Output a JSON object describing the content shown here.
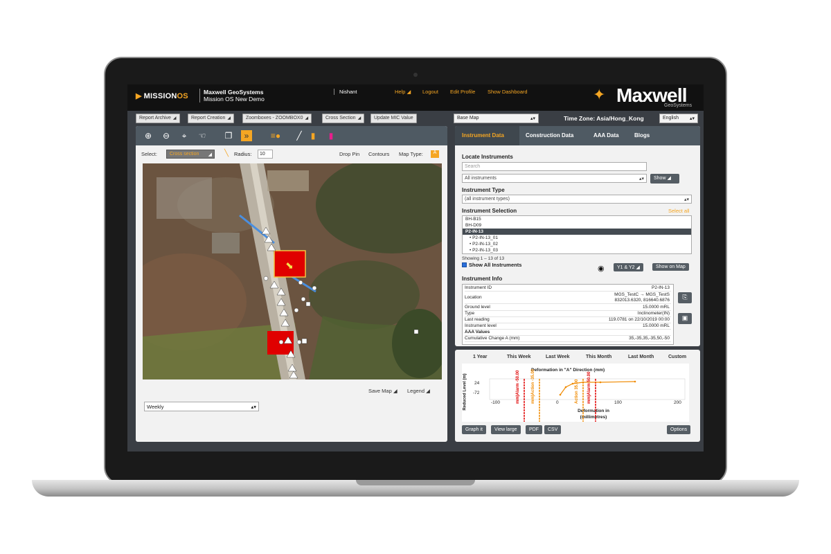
{
  "app": {
    "product_name": "MISSION",
    "product_suffix": "OS",
    "company": "Maxwell GeoSystems",
    "project": "Mission OS New Demo",
    "user": "Nishant",
    "nav": [
      "Help",
      "Logout",
      "Edit Profile",
      "Show Dashboard"
    ],
    "brand": "Maxwell",
    "brand_sub": "GeoSystems"
  },
  "toolbar": {
    "buttons": [
      "Report Archive",
      "Report Creation",
      "Zoomboxes - ZOOMBOX0",
      "Cross Section",
      "Update MIC Value"
    ],
    "basemap": "Base Map",
    "timezone": "Time Zone: Asia/Hong_Kong",
    "language": "English"
  },
  "map_panel": {
    "select_label": "Select:",
    "select_value": "Cross section",
    "radius_label": "Radius:",
    "radius_value": "10",
    "drop_pin": "Drop Pin",
    "contours": "Contours",
    "map_type": "Map Type:",
    "map_type_icon": "A",
    "save_map": "Save Map",
    "legend": "Legend",
    "period": "Weekly"
  },
  "right_panel": {
    "tabs": [
      "Instrument Data",
      "Construction Data",
      "AAA Data",
      "Blogs"
    ],
    "locate_title": "Locate Instruments",
    "search_placeholder": "Search",
    "all_instruments": "All instruments",
    "show_btn": "Show",
    "type_title": "Instrument Type",
    "type_value": "(all instrument types)",
    "selection_title": "Instrument Selection",
    "select_all": "Select all",
    "list": [
      "BH-B15",
      "BH-D09",
      "P2-IN-13",
      "• P2-IN-13_01",
      "• P2-IN-13_02",
      "• P2-IN-13_03"
    ],
    "showing": "Showing 1 – 13 of 13",
    "show_all": "Show All Instruments",
    "y_btn": "Y1 & Y2",
    "show_on_map": "Show on Map",
    "info_title": "Instrument Info",
    "info": [
      {
        "k": "Instrument ID",
        "v": "P2-IN-13"
      },
      {
        "k": "Location",
        "v": "MGS_TestC → MGS_TestS"
      },
      {
        "k": "",
        "v": "832013.6320, 816640.6876"
      },
      {
        "k": "Ground level",
        "v": "15.0000 mRL"
      },
      {
        "k": "Type",
        "v": "Inclinometer(IN)"
      },
      {
        "k": "Last reading",
        "v": "119.0781 on 22/10/2019 00:00"
      },
      {
        "k": "Instrument level",
        "v": "15.0000 mRL"
      },
      {
        "k": "AAA Values",
        "v": ""
      },
      {
        "k": "Cumulative Change A (mm)",
        "v": "35,-35,35,-35,50,-50"
      }
    ]
  },
  "graph_panel": {
    "periods": [
      "1 Year",
      "This Week",
      "Last Week",
      "This Month",
      "Last Month",
      "Custom"
    ],
    "chart_title": "Deformation in \"A\" Direction (mm)",
    "ylabel": "Reduced Level (m)",
    "xlabel": "Deformation in (millimetres)",
    "yticks": [
      "24",
      "-72"
    ],
    "xticks": [
      "-100",
      "0",
      "100",
      "200"
    ],
    "alarm_labels": [
      "mm)Alarm -50.00",
      "mm)Action -35.00",
      "Action 35.00",
      "mm)Alarm 50.00"
    ],
    "buttons": [
      "Graph it",
      "View large",
      "PDF",
      "CSV",
      "Options"
    ]
  },
  "colors": {
    "accent": "#f5a623",
    "panel_header": "#4f5a63",
    "alarm": "#e00000",
    "action": "#f08a00"
  }
}
